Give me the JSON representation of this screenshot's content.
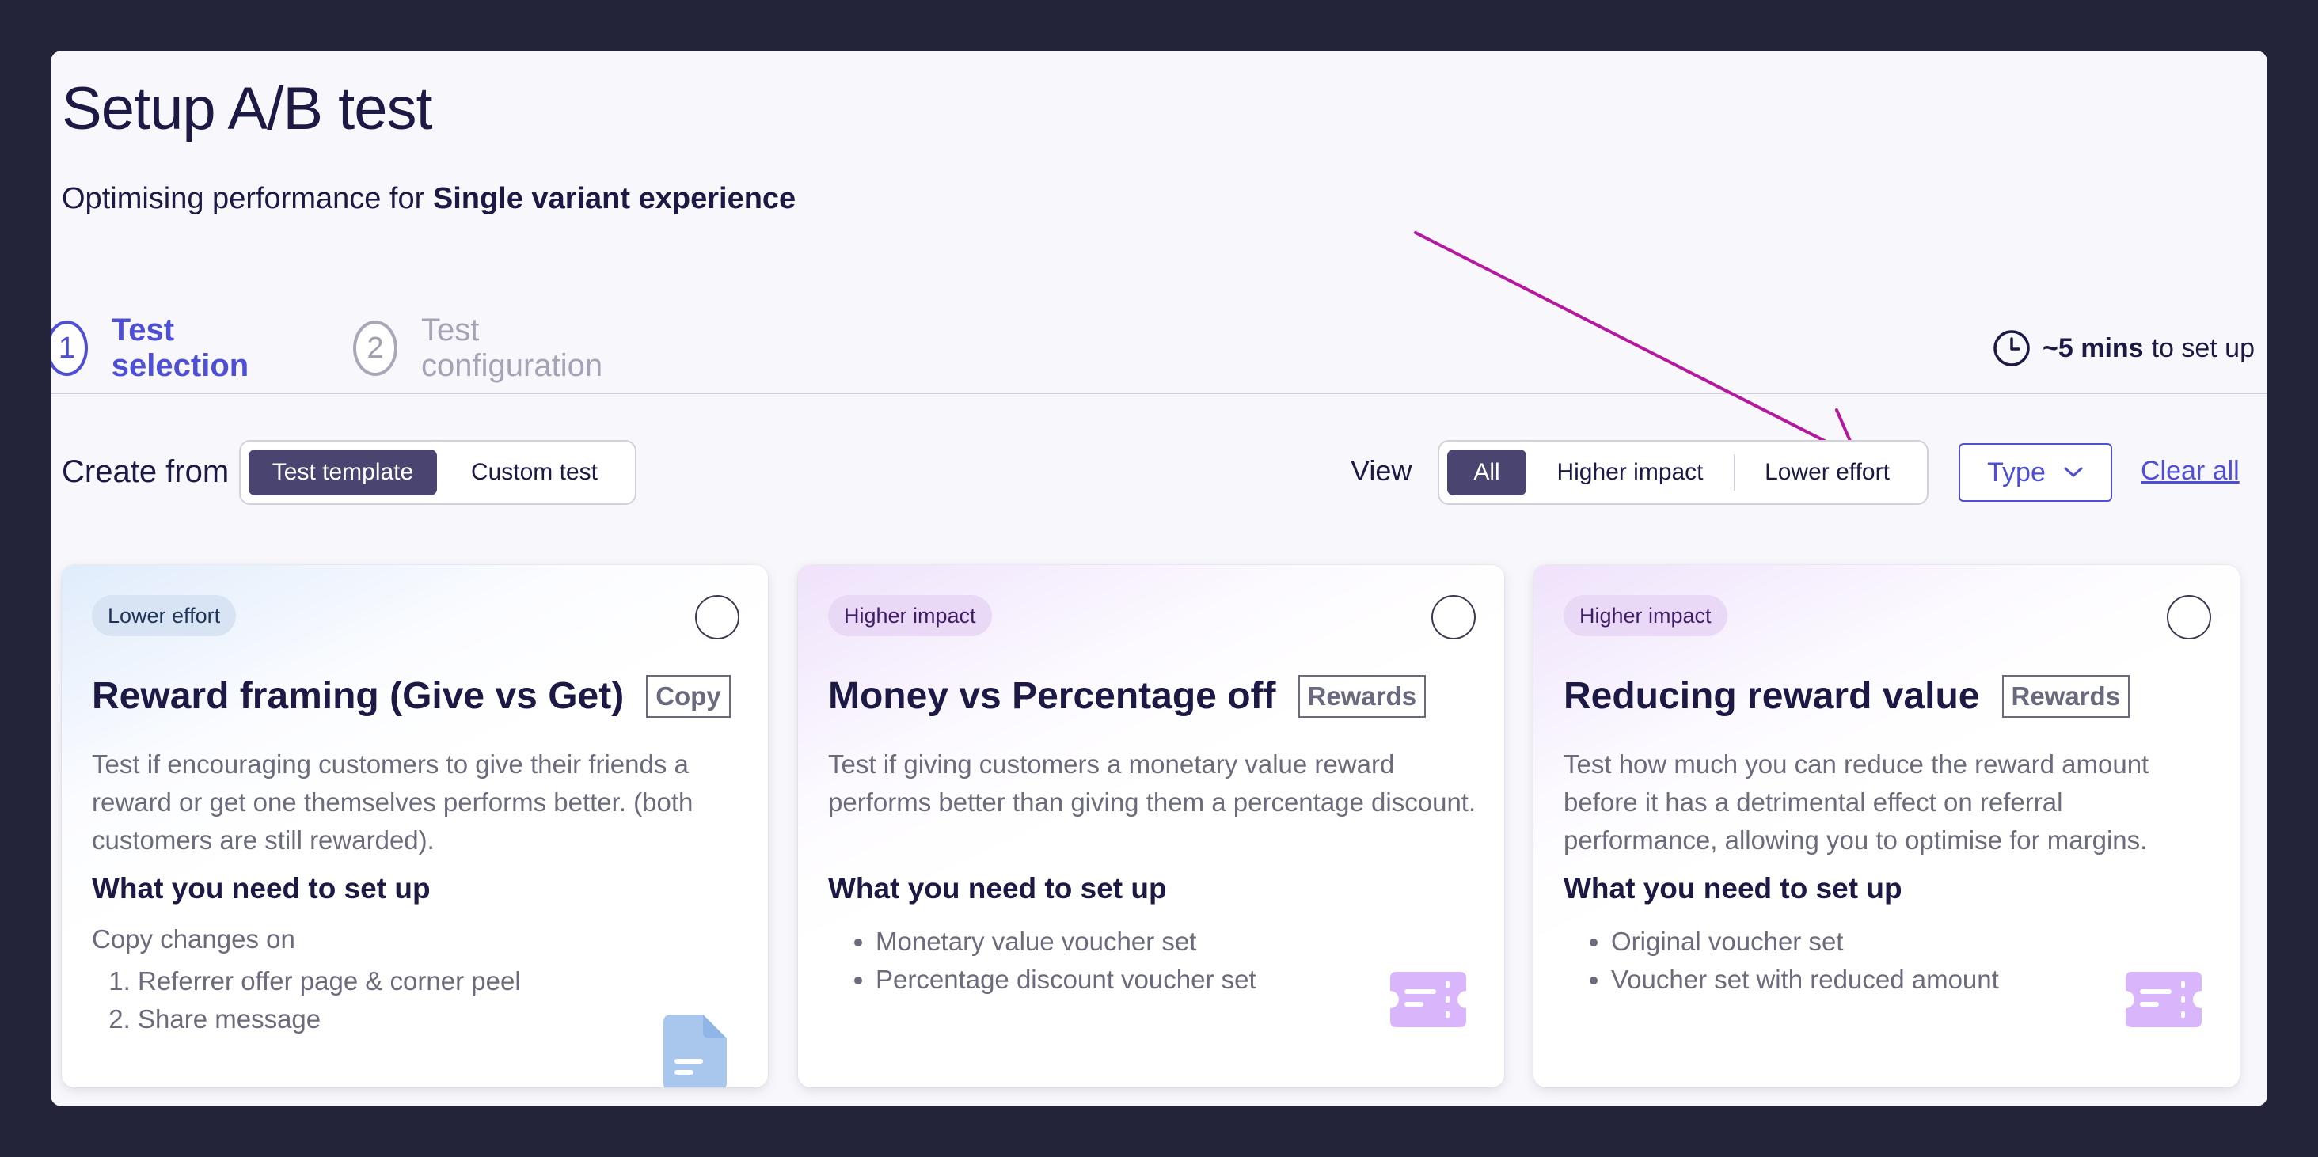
{
  "page": {
    "title": "Setup A/B test",
    "subtitle_prefix": "Optimising performance for",
    "subtitle_bold": "Single variant experience"
  },
  "stepper": {
    "steps": [
      {
        "number": "1",
        "label": "Test selection",
        "state": "active"
      },
      {
        "number": "2",
        "label": "Test configuration",
        "state": "inactive"
      }
    ],
    "time_bold": "~5 mins",
    "time_suffix": "to set up"
  },
  "filters": {
    "create_from_label": "Create from",
    "create_options": [
      "Test template",
      "Custom test"
    ],
    "create_selected": "Test template",
    "view_label": "View",
    "view_options": [
      "All",
      "Higher impact",
      "Lower effort"
    ],
    "view_selected": "All",
    "type_label": "Type",
    "clear_label": "Clear all"
  },
  "cards": [
    {
      "badge": "Lower effort",
      "title": "Reward framing (Give vs Get)",
      "tag": "Copy",
      "description": "Test if encouraging customers to give their friends a reward or get one themselves performs better. (both customers are still rewarded).",
      "need_title": "What you need to set up",
      "note": "Copy changes on",
      "items": [
        "Referrer offer page & corner peel",
        "Share message"
      ],
      "icon": "document-icon",
      "selected": false
    },
    {
      "badge": "Higher impact",
      "title": "Money vs Percentage off",
      "tag": "Rewards",
      "description": "Test if giving customers a monetary value reward performs better than giving them a percentage discount.",
      "need_title": "What you need to set up",
      "items": [
        "Monetary value voucher set",
        "Percentage discount voucher set"
      ],
      "icon": "voucher-icon",
      "selected": false
    },
    {
      "badge": "Higher impact",
      "title": "Reducing reward value",
      "tag": "Rewards",
      "description": "Test how much you can reduce the reward amount before it has a detrimental effect on referral performance, allowing you to optimise for margins.",
      "need_title": "What you need to set up",
      "items": [
        "Original voucher set",
        "Voucher set with reduced amount"
      ],
      "icon": "voucher-icon",
      "selected": false
    }
  ],
  "colors": {
    "background": "#23233a",
    "panel": "#f8f8fc",
    "accent": "#4f4fd6",
    "segment_active": "#4a4470",
    "annotation_arrow": "#b5179e",
    "doc_icon": "#a9c7ec",
    "voucher_icon": "#d9b6fb"
  }
}
